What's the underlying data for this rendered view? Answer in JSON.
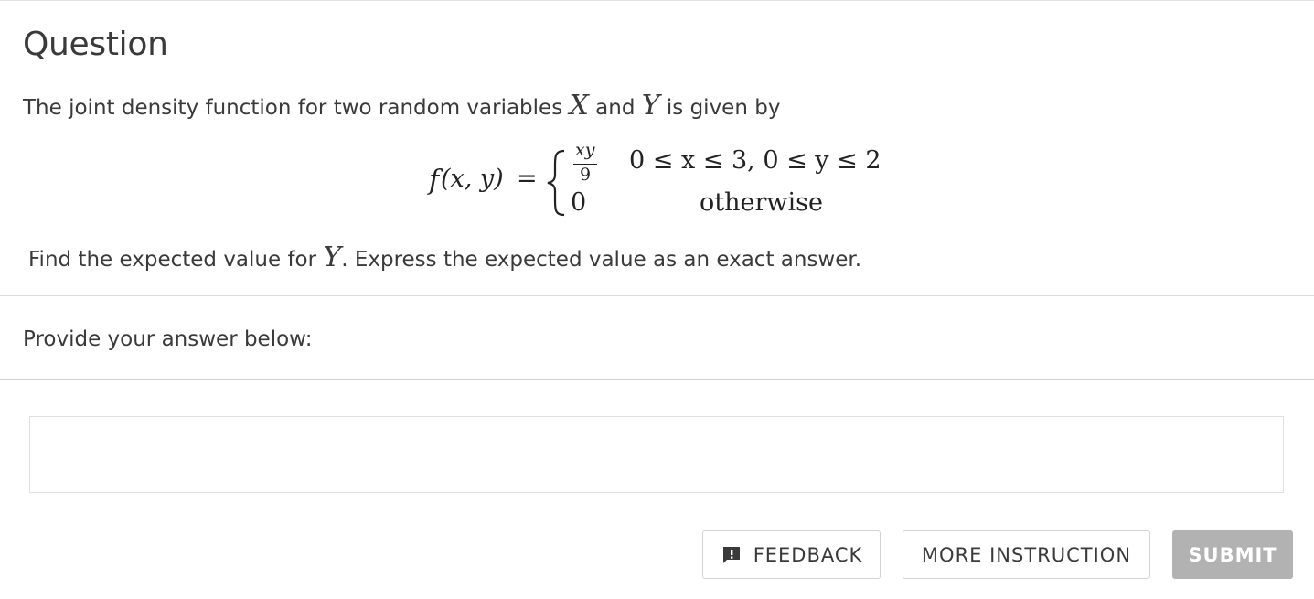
{
  "question": {
    "title": "Question",
    "intro": {
      "text_before": "The joint density function for two random variables ",
      "var_x": "X",
      "text_between": " and ",
      "var_y": "Y",
      "text_after": " is given by"
    },
    "formula": {
      "lhs_f": "f",
      "lhs_args": " (x, y)",
      "equals": "=",
      "case1_num": "xy",
      "case1_den": "9",
      "case1_condition": "0 ≤ x ≤ 3,  0 ≤ y ≤ 2",
      "case2_value": "0",
      "case2_condition": "otherwise"
    },
    "find": {
      "text_before": "Find the expected value for ",
      "var_y": "Y",
      "text_after": ". Express the expected value as an exact answer."
    }
  },
  "answer": {
    "prompt": "Provide your answer below:",
    "value": ""
  },
  "buttons": {
    "feedback": "FEEDBACK",
    "more_instruction": "MORE INSTRUCTION",
    "submit": "SUBMIT"
  },
  "colors": {
    "submit_disabled": "#b2b2b2",
    "text": "#3a3a3a",
    "border": "#d4d4d4"
  },
  "icons": {
    "feedback": "feedback-exclamation-icon"
  }
}
